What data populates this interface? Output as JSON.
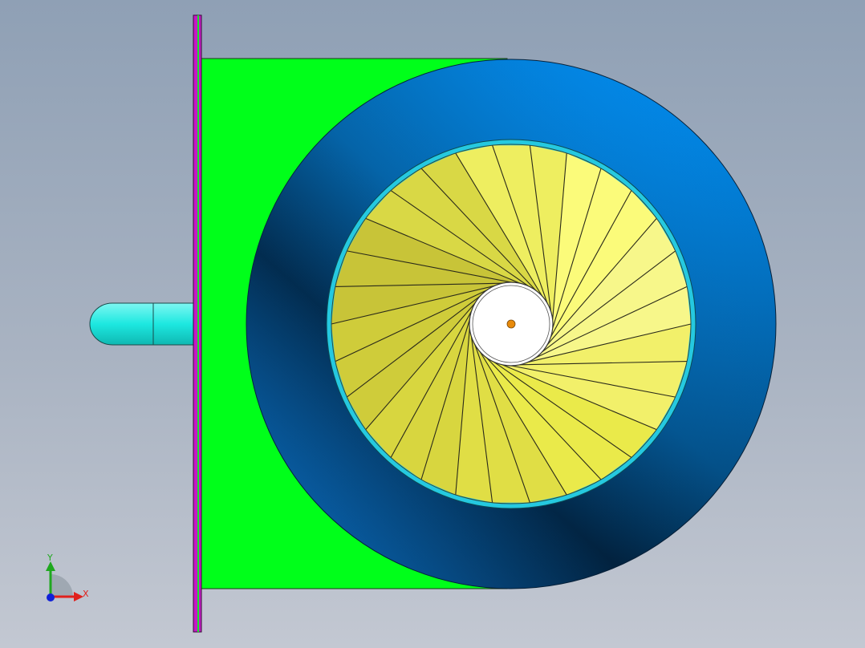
{
  "triad": {
    "x_label": "X",
    "y_label": "Y",
    "x_color": "#e0201c",
    "y_color": "#1fa81f",
    "z_color": "#1020d8"
  },
  "model": {
    "housing_color": "#00ff1a",
    "flange_plate_color": "#c41bc4",
    "volute_color": "#0288e0",
    "inner_ring_color": "#25c9e0",
    "blade_color": "#eaea4a",
    "hub_color": "#ffffff",
    "center_point_color": "#e88a0a",
    "pipe_color": "#1de8e0",
    "blade_count": 30
  }
}
